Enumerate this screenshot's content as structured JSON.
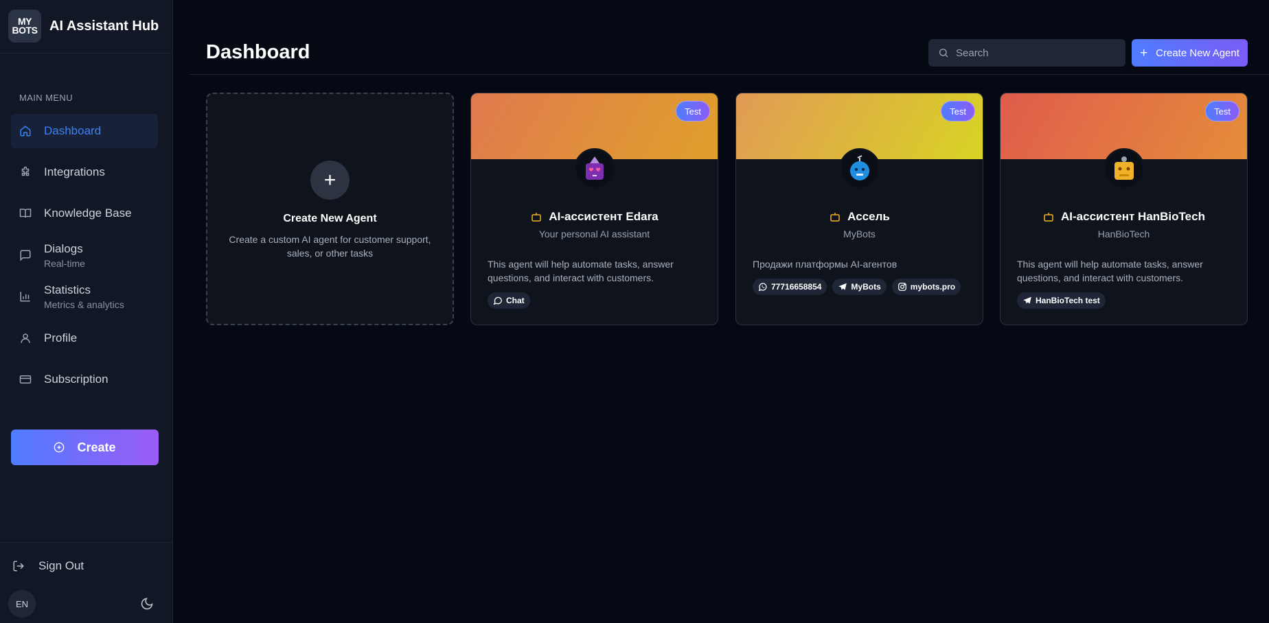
{
  "brand": {
    "logo_line1": "MY",
    "logo_line2": "BOTS",
    "title": "AI Assistant Hub"
  },
  "sidebar": {
    "menu_heading": "MAIN MENU",
    "items": [
      {
        "label": "Dashboard",
        "sub": "",
        "icon": "home-icon"
      },
      {
        "label": "Integrations",
        "sub": "",
        "icon": "puzzle-icon"
      },
      {
        "label": "Knowledge Base",
        "sub": "",
        "icon": "book-icon"
      },
      {
        "label": "Dialogs",
        "sub": "Real-time",
        "icon": "chat-icon"
      },
      {
        "label": "Statistics",
        "sub": "Metrics & analytics",
        "icon": "bar-chart-icon"
      },
      {
        "label": "Profile",
        "sub": "",
        "icon": "user-icon"
      },
      {
        "label": "Subscription",
        "sub": "",
        "icon": "credit-card-icon"
      }
    ],
    "create_label": "Create",
    "sign_out_label": "Sign Out",
    "language": "EN"
  },
  "header": {
    "title": "Dashboard",
    "search_placeholder": "Search",
    "new_agent_label": "Create New Agent"
  },
  "new_agent_card": {
    "title": "Create New Agent",
    "description": "Create a custom AI agent for customer support, sales, or other tasks"
  },
  "agents": [
    {
      "tag": "Test",
      "name": "AI-ассистент Edara",
      "subtitle": "Your personal AI assistant",
      "description": "This agent will help automate tasks, answer questions, and interact with customers.",
      "banner_from": "#e07a4f",
      "banner_to": "#e0a02a",
      "avatar_color": "#7e2fb0",
      "chips": [
        {
          "icon": "chat-bubble-icon",
          "label": "Chat"
        }
      ]
    },
    {
      "tag": "Test",
      "name": "Ассель",
      "subtitle": "MyBots",
      "description": "Продажи платформы AI-агентов",
      "banner_from": "#e19a55",
      "banner_to": "#d8d424",
      "avatar_color": "#1f8ee0",
      "chips": [
        {
          "icon": "whatsapp-icon",
          "label": "77716658854"
        },
        {
          "icon": "telegram-icon",
          "label": "MyBots"
        },
        {
          "icon": "instagram-icon",
          "label": "mybots.pro"
        }
      ]
    },
    {
      "tag": "Test",
      "name": "AI-ассистент HanBioTech",
      "subtitle": "HanBioTech",
      "description": "This agent will help automate tasks, answer questions, and interact with customers.",
      "banner_from": "#e05c4c",
      "banner_to": "#e48d3a",
      "avatar_color": "#f0b22a",
      "chips": [
        {
          "icon": "telegram-icon",
          "label": "HanBioTech test"
        }
      ]
    }
  ],
  "colors": {
    "accent": "#3b82f6",
    "background": "#050914",
    "sidebar": "#111725",
    "card": "#0f131b"
  }
}
